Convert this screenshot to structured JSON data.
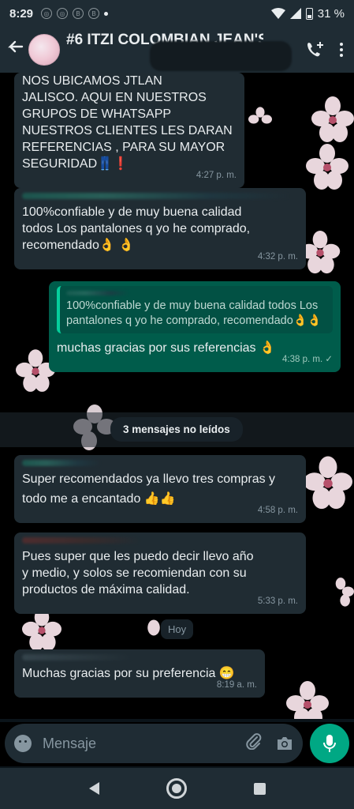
{
  "status_bar": {
    "time": "8:29",
    "battery": "31 %"
  },
  "header": {
    "title": "#6 ITZI COLOMBIAN  JEAN'S"
  },
  "messages": [
    {
      "direction": "incoming",
      "text": "NOS UBICAMOS EN JALISCO. AQUI EN NUESTROS GRUPOS DE WHATSAPP NUESTROS CLIENTES LES DARAN REFERENCIAS , PARA SU MAYOR SEGURIDAD👖❗",
      "lines": [
        "NOS UBICAMOS        JTLAN",
        "JALISCO. AQUI EN NUESTROS",
        "GRUPOS DE WHATSAPP",
        "NUESTROS CLIENTES LES DARAN",
        "REFERENCIAS , PARA SU MAYOR",
        "SEGURIDAD👖❗"
      ],
      "time": "4:27 p. m."
    },
    {
      "direction": "incoming",
      "text": "100%confiable y de muy buena calidad todos Los pantalones q yo he comprado, recomendado👌👌",
      "lines": [
        "100%confiable y de muy buena calidad",
        "todos Los pantalones q yo he comprado,",
        "recomendado👌 👌"
      ],
      "time": "4:32 p. m."
    },
    {
      "direction": "outgoing",
      "quote": "100%confiable y de muy buena calidad todos Los pantalones q yo he comprado, recomendado👌👌",
      "text": "muchas gracias por sus referencias 👌",
      "time": "4:38 p. m. ✓"
    },
    {
      "direction": "incoming",
      "text": "Super recomendados ya llevo tres compras y todo me a encantado 👍👍",
      "lines": [
        "Super recomendados ya llevo tres compras y",
        "todo me a encantado 👍👍"
      ],
      "time": "4:58 p. m."
    },
    {
      "direction": "incoming",
      "text": "Pues super que les puedo decir llevo año y medio, y solos se recomiendan con su productos de máxima calidad.",
      "lines": [
        "Pues super que les puedo decir llevo año",
        "y medio, y solos se recomiendan con su",
        "productos de máxima calidad."
      ],
      "time": "5:33 p. m."
    },
    {
      "direction": "incoming",
      "text": "Muchas gracias por su preferencia 😁",
      "time": "8:19 a. m."
    }
  ],
  "unread_label": "3 mensajes no leídos",
  "date_label": "Hoy",
  "composer": {
    "placeholder": "Mensaje"
  },
  "colors": {
    "header_bg": "#1f2c34",
    "incoming_bubble": "#202c33",
    "outgoing_bubble": "#005c4b",
    "accent": "#00a884"
  }
}
